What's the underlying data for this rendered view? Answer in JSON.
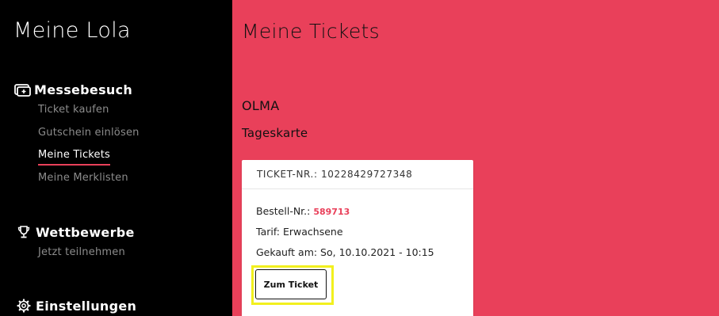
{
  "sidebar": {
    "app_title": "Meine Lola",
    "sections": [
      {
        "title": "Messebesuch",
        "icon": "ticket-icon",
        "items": [
          {
            "label": "Ticket kaufen",
            "active": false
          },
          {
            "label": "Gutschein einlösen",
            "active": false
          },
          {
            "label": "Meine Tickets",
            "active": true
          },
          {
            "label": "Meine Merklisten",
            "active": false
          }
        ]
      },
      {
        "title": "Wettbewerbe",
        "icon": "trophy-icon",
        "items": [
          {
            "label": "Jetzt teilnehmen",
            "active": false
          }
        ]
      },
      {
        "title": "Einstellungen",
        "icon": "gear-icon",
        "items": []
      }
    ]
  },
  "main": {
    "title": "Meine Tickets",
    "event": "OLMA",
    "ticket_type": "Tageskarte",
    "ticket": {
      "number_label": "TICKET-NR.: 10228429727348",
      "order_label": "Bestell-Nr.: ",
      "order_number": "589713",
      "tariff": "Tarif: Erwachsene",
      "purchased": "Gekauft am: So, 10.10.2021 - 10:15",
      "button_label": "Zum Ticket"
    }
  },
  "colors": {
    "accent": "#e9405a",
    "sidebar_bg": "#000000",
    "highlight": "#f2f01e"
  }
}
